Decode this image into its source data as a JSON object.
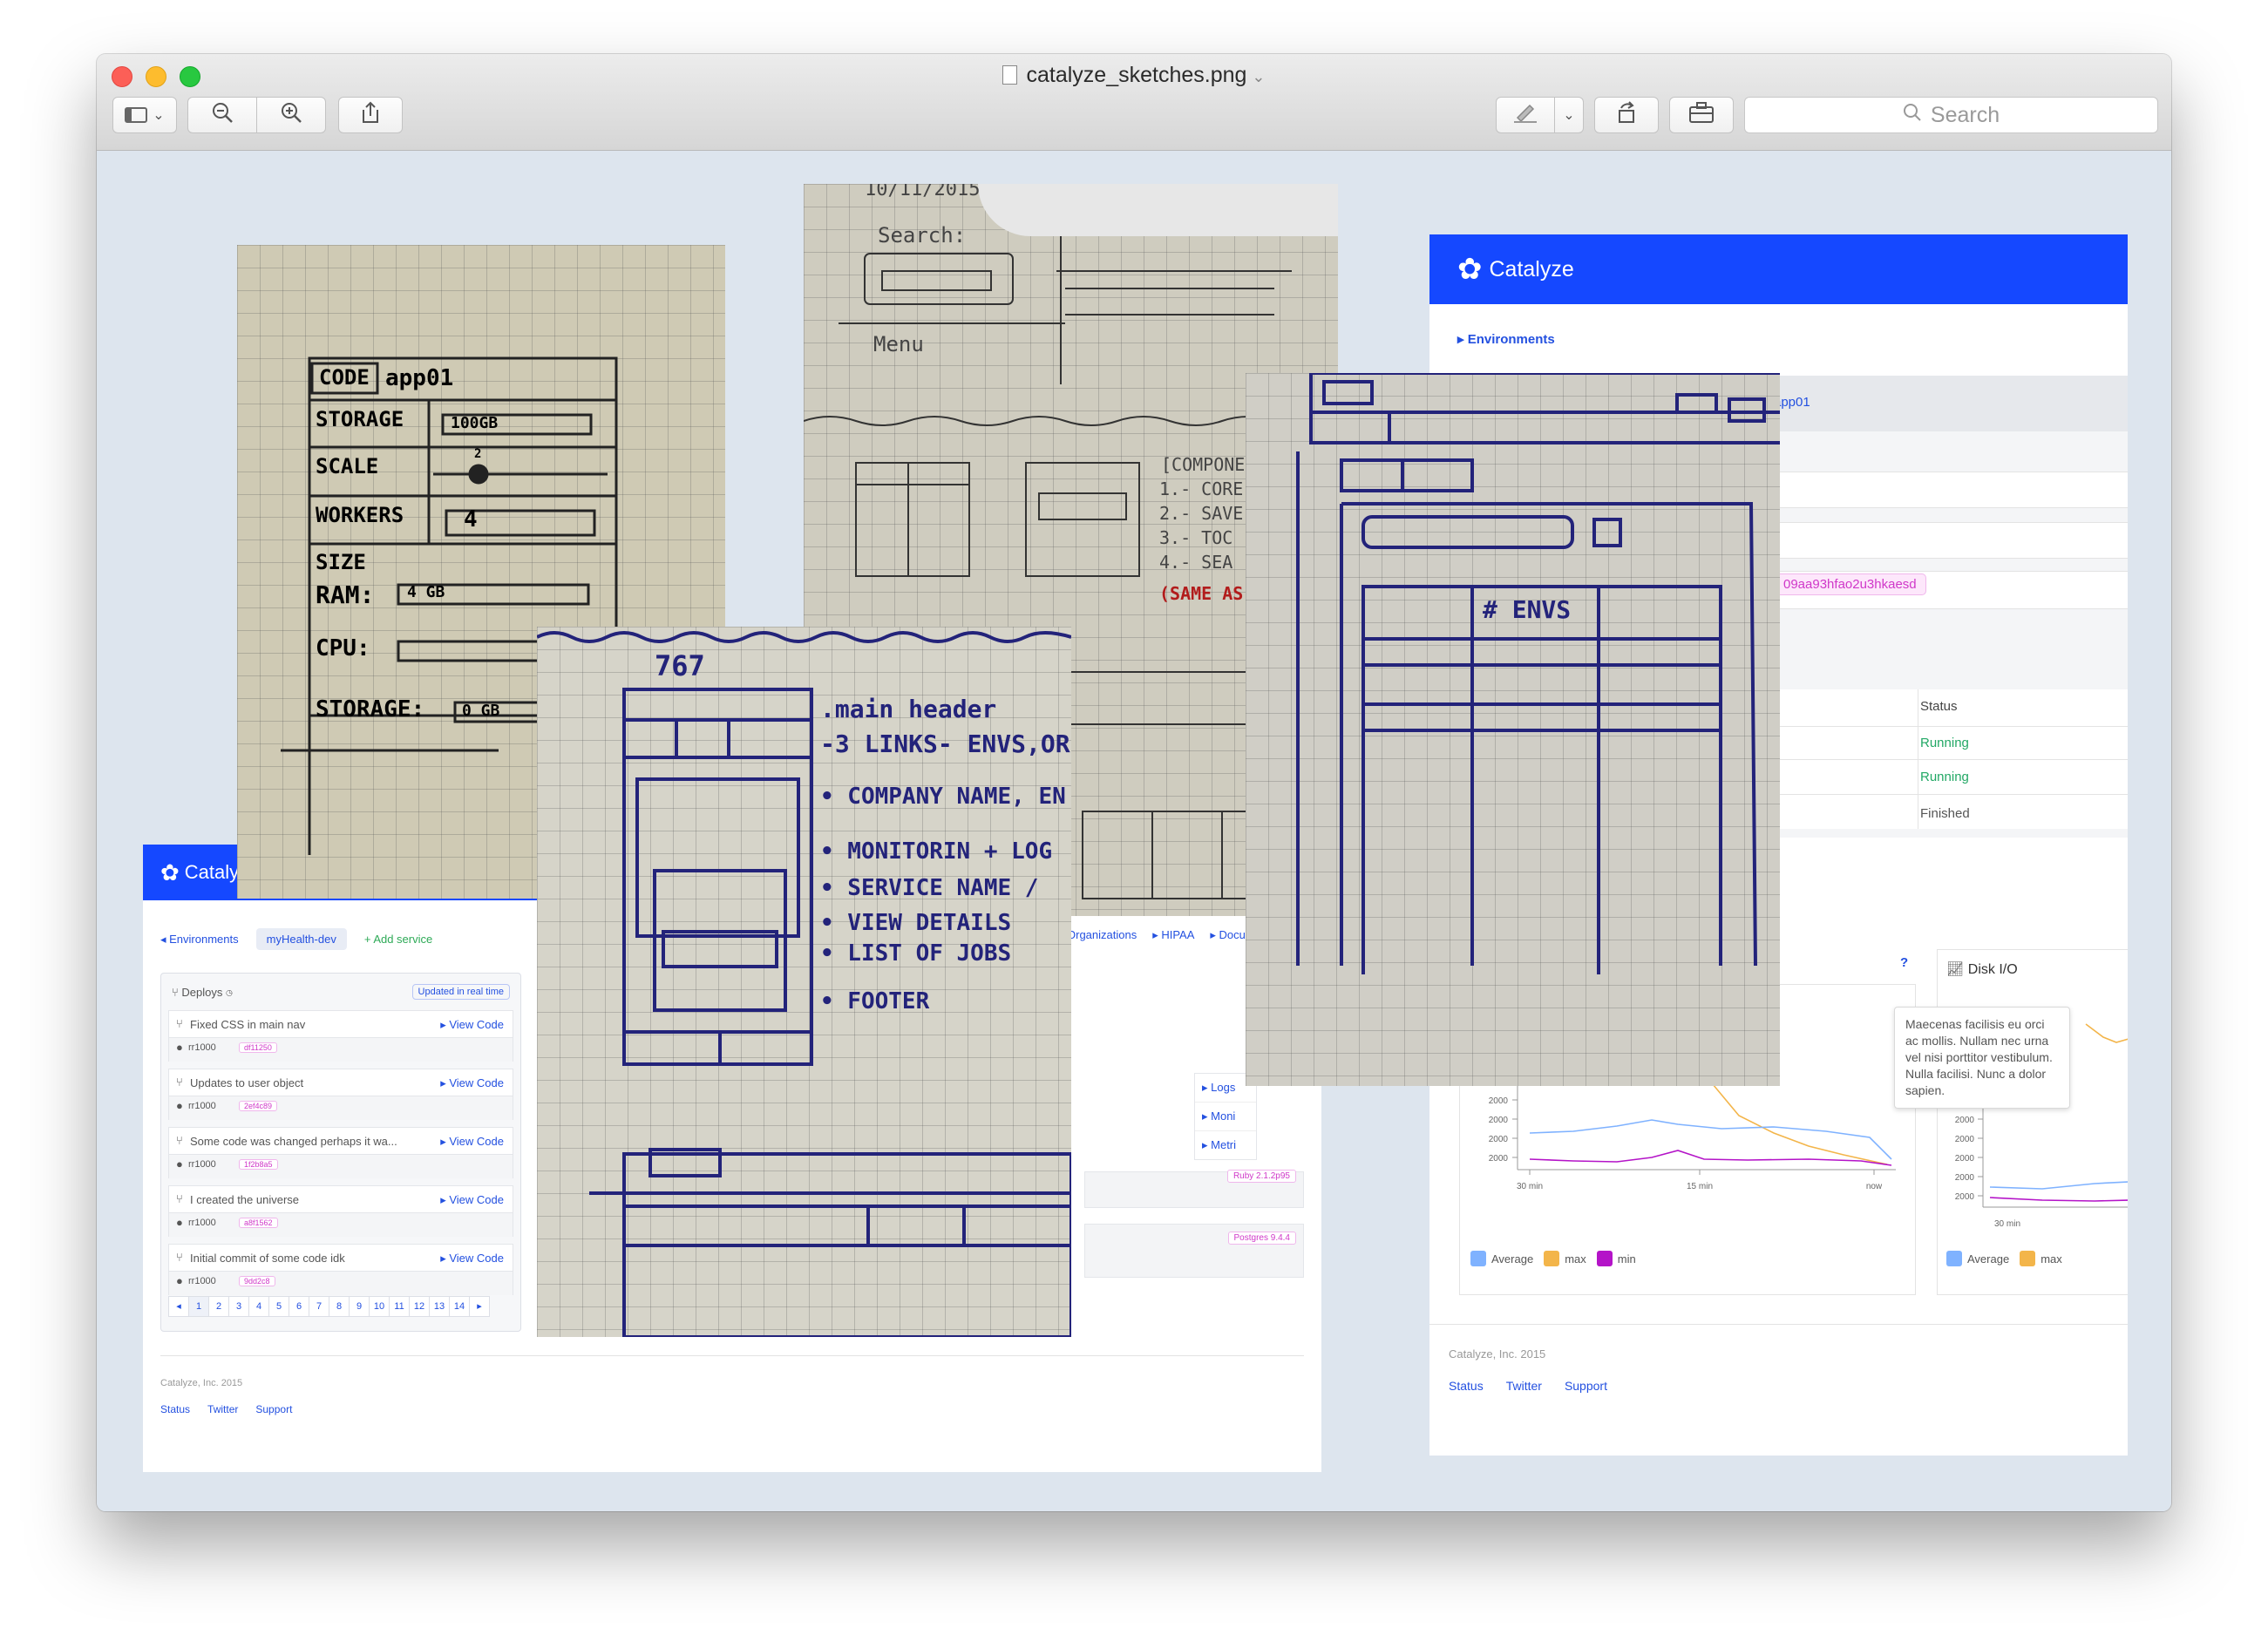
{
  "window": {
    "title": "catalyze_sketches.png",
    "search_placeholder": "Search"
  },
  "sketch_storage": {
    "code_label": "CODE",
    "app": "app01",
    "storage_label": "STORAGE",
    "storage_value": "100GB",
    "scale_label": "SCALE",
    "scale_value": "2",
    "workers_label": "WORKERS",
    "workers_value": "4",
    "size_label": "SIZE",
    "ram_label": "RAM:",
    "ram_value": "4 GB",
    "cpu_label": "CPU:",
    "storage2_label": "STORAGE:",
    "storage2_value": "0 GB"
  },
  "sketch_search": {
    "date": "10/11/2015",
    "search_label": "Search:",
    "menu_label": "Menu",
    "components_label": "[COMPONE",
    "items": [
      "1.- CORE A",
      "2.- SAVE",
      "3.- TOC",
      "4.- SEA"
    ],
    "note": "(SAME AS"
  },
  "sketch_mobile": {
    "width_label": "767",
    "notes": [
      ".main header",
      "-3 LINKS- ENVS,ORG",
      "• COMPANY NAME, EN",
      "• MONITORIN + LOG",
      "• SERVICE NAME /",
      "• VIEW DETAILS",
      "• LIST OF JOBS",
      "• FOOTER"
    ]
  },
  "sketch_table": {
    "col_label": "# ENVS"
  },
  "mock_left": {
    "brand": "Catalyze",
    "breadcrumb_env": "◂ Environments",
    "env_pill": "myHealth-dev",
    "add_service": "+ Add service",
    "nav_links": [
      "Organizations",
      "▸ HIPAA",
      "▸ Docu"
    ],
    "deploys_title": "Deploys",
    "realtime": "Updated in real time",
    "view_code": "▸ View Code",
    "deploys": [
      {
        "msg": "Fixed CSS in main nav",
        "user": "rr1000",
        "hash": "df11250"
      },
      {
        "msg": "Updates to user object",
        "user": "rr1000",
        "hash": "2ef4c89"
      },
      {
        "msg": "Some code was changed perhaps it wa...",
        "user": "rr1000",
        "hash": "1f2b8a5"
      },
      {
        "msg": "I created the universe",
        "user": "rr1000",
        "hash": "a8f1562"
      },
      {
        "msg": "Initial commit of some code idk",
        "user": "rr1000",
        "hash": "9dd2c8"
      }
    ],
    "pages": [
      "◂",
      "1",
      "2",
      "3",
      "4",
      "5",
      "6",
      "7",
      "8",
      "9",
      "10",
      "11",
      "12",
      "13",
      "14",
      "▸"
    ],
    "side_links": [
      "▸ Logs",
      "▸ Moni",
      "▸ Metri"
    ],
    "tags": [
      "Ruby 2.1.2p95",
      "Postgres 9.4.4"
    ],
    "footer_copy": "Catalyze, Inc. 2015",
    "footer_links": [
      "Status",
      "Twitter",
      "Support"
    ]
  },
  "mock_right": {
    "brand": "Catalyze",
    "breadcrumb": "▸ Environments",
    "app_link": "app01",
    "hash": "09aa93hfao2u3hkaesd",
    "status_header": "Status",
    "statuses": [
      "Running",
      "Running",
      "Finished"
    ],
    "disk_title": "Disk I/O",
    "help": "?",
    "tooltip": "Maecenas facilisis eu orci ac mollis. Nullam nec urna vel nisi porttitor vestibulum. Nulla facilisi. Nunc a dolor sapien.",
    "y_ticks": [
      "2000",
      "2000",
      "2000",
      "2000",
      "2000",
      "2000",
      "2000",
      "2000",
      "2000"
    ],
    "x_ticks": [
      "30 min",
      "15 min",
      "now"
    ],
    "x_ticks2": [
      "30 min"
    ],
    "legend": [
      "Average",
      "max",
      "min"
    ],
    "legend2": [
      "Average",
      "max"
    ],
    "footer_copy": "Catalyze, Inc. 2015",
    "footer_links": [
      "Status",
      "Twitter",
      "Support"
    ],
    "colors": {
      "average": "#7fb2ff",
      "max": "#f3b54a",
      "min": "#b414c8"
    }
  }
}
